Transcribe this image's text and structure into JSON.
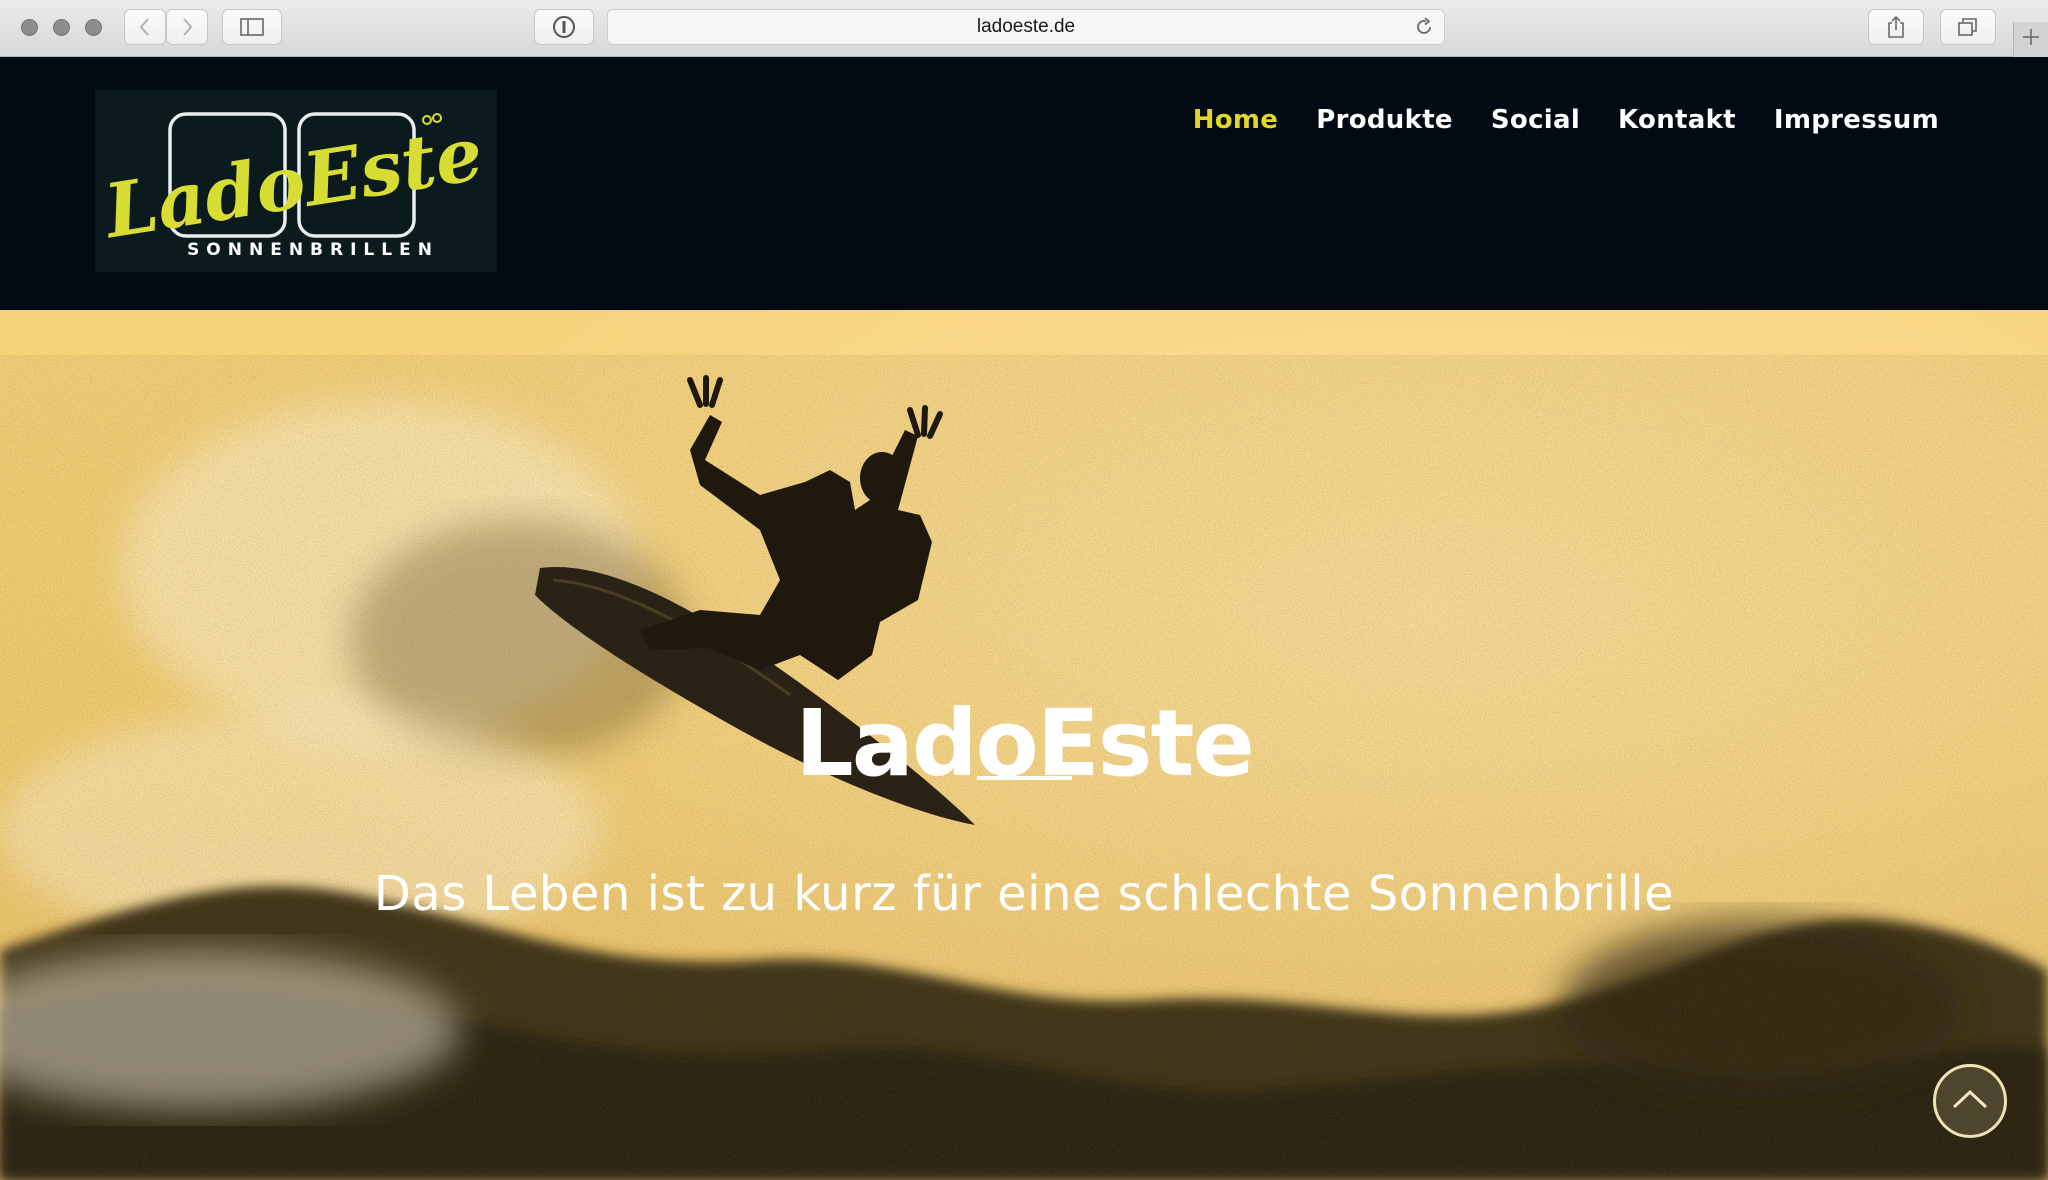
{
  "browser": {
    "url": "ladoeste.de",
    "icons": {
      "back": "chevron-left-icon",
      "forward": "chevron-right-icon",
      "sidebar": "sidebar-icon",
      "privacy": "info-icon",
      "reload": "reload-icon",
      "share": "share-icon",
      "tabs": "tabs-icon",
      "new_tab": "plus-icon"
    }
  },
  "header": {
    "logo": {
      "wordmark": "LadoEste",
      "tagline": "SONNENBRILLEN"
    },
    "nav": [
      {
        "label": "Home",
        "active": true
      },
      {
        "label": "Produkte",
        "active": false
      },
      {
        "label": "Social",
        "active": false
      },
      {
        "label": "Kontakt",
        "active": false
      },
      {
        "label": "Impressum",
        "active": false
      }
    ]
  },
  "hero": {
    "title": "LadoEste",
    "subtitle": "Das Leben ist zu kurz für eine schlechte Sonnenbrille",
    "scroll_top_icon": "chevron-up-icon"
  },
  "colors": {
    "header_bg": "#020b13",
    "accent": "#e3d62b",
    "hero_tint": "#f5c95c"
  }
}
